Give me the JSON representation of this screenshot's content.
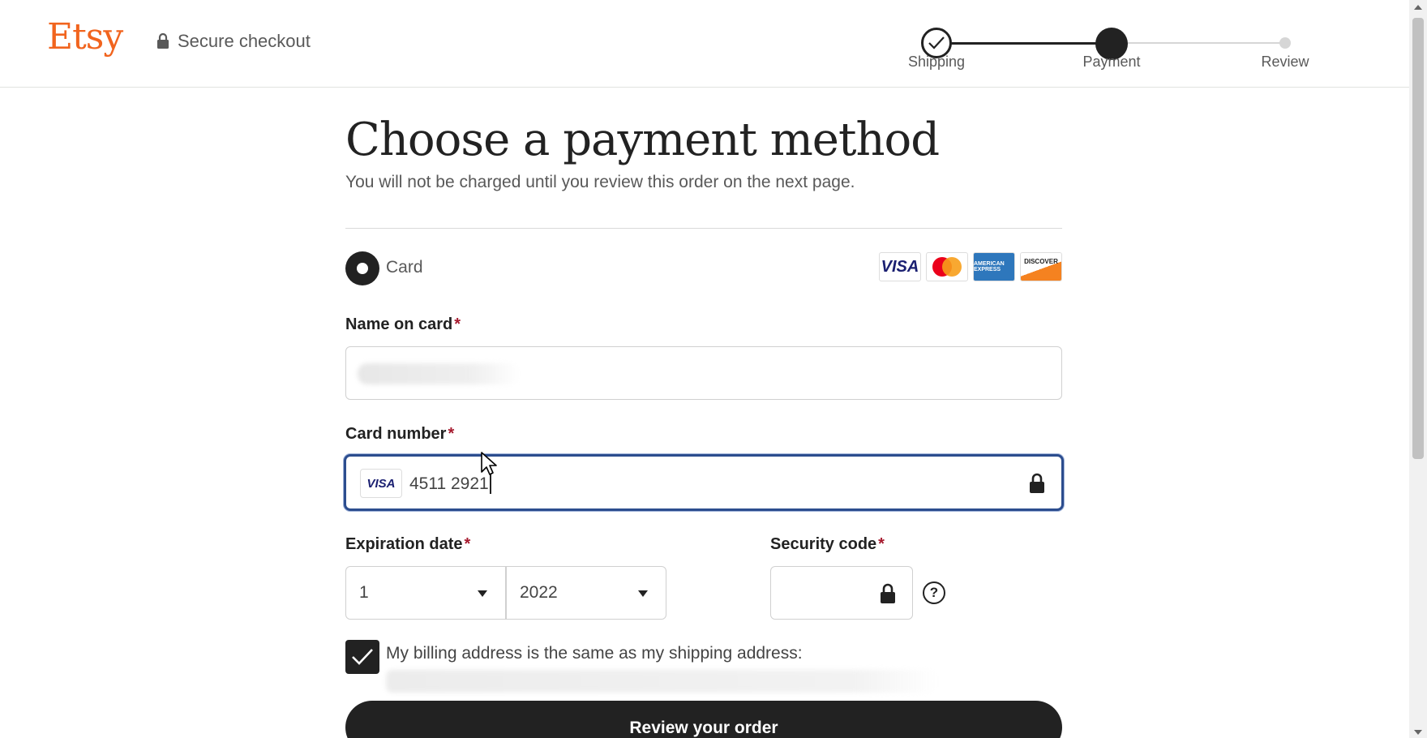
{
  "header": {
    "logo": "Etsy",
    "secure_label": "Secure checkout",
    "steps": [
      {
        "label": "Shipping",
        "state": "complete"
      },
      {
        "label": "Payment",
        "state": "current"
      },
      {
        "label": "Review",
        "state": "upcoming"
      }
    ]
  },
  "main": {
    "title": "Choose a payment method",
    "subtitle": "You will not be charged until you review this order on the next page.",
    "method": {
      "label": "Card",
      "selected": true,
      "brands": [
        "VISA",
        "Mastercard",
        "American Express",
        "DISCOVER"
      ],
      "visa_text": "VISA",
      "amex_text": "AMERICAN EXPRESS",
      "discover_text": "DISCOVER"
    },
    "name_on_card": {
      "label": "Name on card",
      "required_mark": "*"
    },
    "card_number": {
      "label": "Card number",
      "required_mark": "*",
      "value": "4511 2921",
      "brand_chip": "VISA"
    },
    "expiration": {
      "label": "Expiration date",
      "required_mark": "*",
      "month": "1",
      "year": "2022"
    },
    "security_code": {
      "label": "Security code",
      "required_mark": "*",
      "help_icon": "?"
    },
    "billing_same": {
      "label": "My billing address is the same as my shipping address:",
      "checked": true
    },
    "review_button": "Review your order"
  },
  "colors": {
    "brand_orange": "#f1641e",
    "focus_border": "#2c4d8e",
    "required_red": "#a61a2e",
    "dark": "#222222"
  }
}
